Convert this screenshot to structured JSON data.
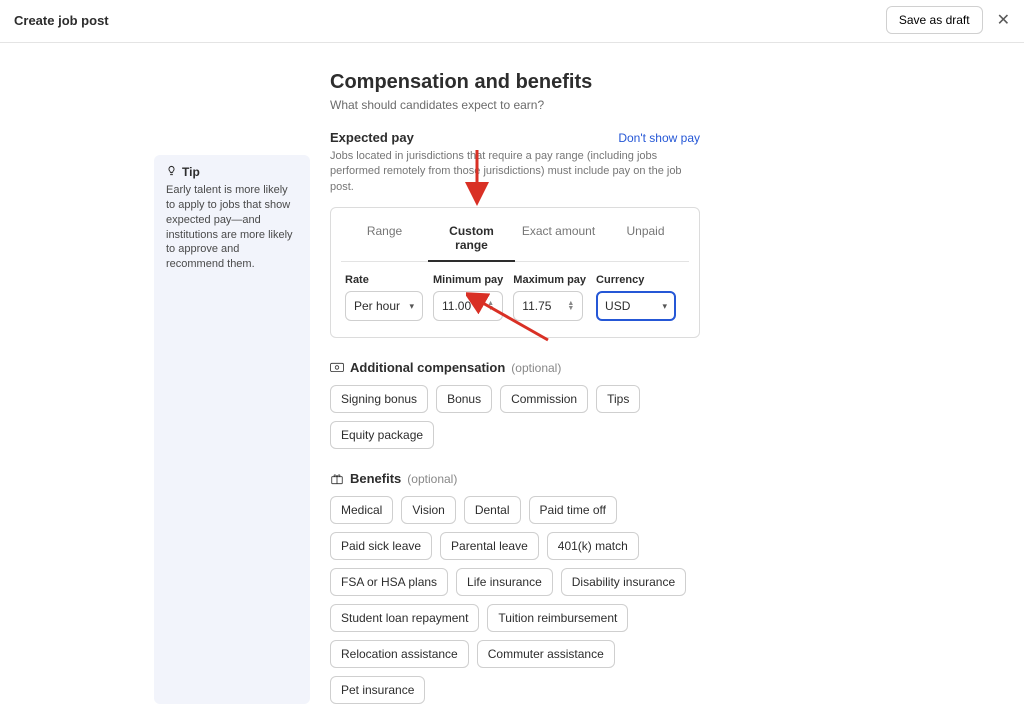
{
  "topbar": {
    "title": "Create job post",
    "save_draft": "Save as draft"
  },
  "tip": {
    "heading": "Tip",
    "body": "Early talent is more likely to apply to jobs that show expected pay—and institutions are more likely to approve and recommend them."
  },
  "page": {
    "h1": "Compensation and benefits",
    "sub": "What should candidates expect to earn?"
  },
  "expected": {
    "title": "Expected pay",
    "dont_show": "Don't show pay",
    "help": "Jobs located in jurisdictions that require a pay range (including jobs performed remotely from those jurisdictions) must include pay on the job post.",
    "tabs": [
      "Range",
      "Custom range",
      "Exact amount",
      "Unpaid"
    ],
    "active_tab": 1,
    "labels": {
      "rate": "Rate",
      "min": "Minimum pay",
      "max": "Maximum pay",
      "currency": "Currency"
    },
    "values": {
      "rate": "Per hour",
      "min": "11.00",
      "max": "11.75",
      "currency": "USD"
    }
  },
  "addcomp": {
    "title": "Additional compensation",
    "optional": "(optional)",
    "chips": [
      "Signing bonus",
      "Bonus",
      "Commission",
      "Tips",
      "Equity package"
    ]
  },
  "benefits": {
    "title": "Benefits",
    "optional": "(optional)",
    "chips": [
      "Medical",
      "Vision",
      "Dental",
      "Paid time off",
      "Paid sick leave",
      "Parental leave",
      "401(k) match",
      "FSA or HSA plans",
      "Life insurance",
      "Disability insurance",
      "Student loan repayment",
      "Tuition reimbursement",
      "Relocation assistance",
      "Commuter assistance",
      "Pet insurance"
    ]
  }
}
